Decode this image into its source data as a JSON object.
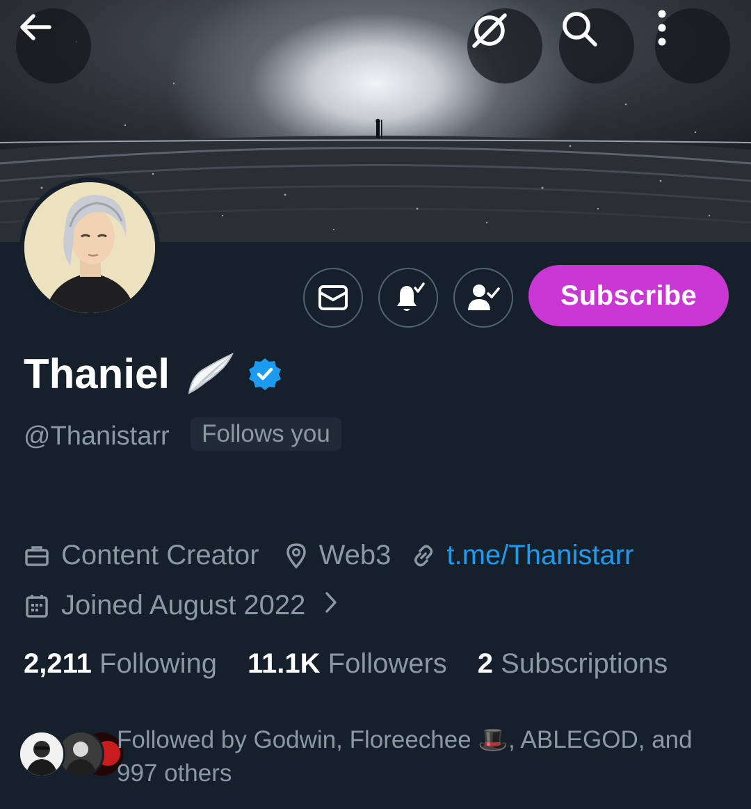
{
  "header": {
    "back_icon": "arrow-left-icon",
    "grok_icon": "grok-slash-icon",
    "search_icon": "search-icon",
    "more_icon": "more-vertical-icon"
  },
  "profile": {
    "display_name": "Thaniel",
    "name_emoji": "wing-emoji",
    "verified_icon": "verified-badge-icon",
    "handle": "@Thanistarr",
    "follows_you": "Follows you",
    "category": "Content Creator",
    "location": "Web3",
    "website": "t.me/Thanistarr",
    "joined": "Joined August 2022"
  },
  "actions": {
    "subscribe_label": "Subscribe",
    "message_icon": "mail-icon",
    "notify_icon": "bell-check-icon",
    "following_icon": "person-check-icon"
  },
  "stats": {
    "following_count": "2,211",
    "following_label": "Following",
    "followers_count": "11.1K",
    "followers_label": "Followers",
    "subscriptions_count": "2",
    "subscriptions_label": "Subscriptions"
  },
  "followed_by": {
    "text": "Followed by Godwin, Floreechee 🎩, ABLEGOD, and 997 others"
  },
  "colors": {
    "background": "#15202b",
    "accent_link": "#1d9bf0",
    "subscribe": "#c936d3",
    "muted_text": "#8b98a5"
  }
}
